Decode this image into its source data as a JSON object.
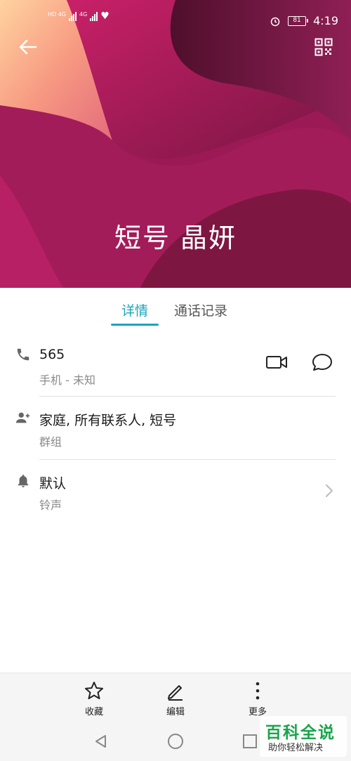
{
  "status_bar": {
    "signal_1": "HD 4G",
    "signal_2": "4G",
    "battery": "81",
    "time": "4:19",
    "alarm_icon": "alarm-icon",
    "heart_icon": "heart-icon"
  },
  "header": {
    "back_icon": "back-arrow-icon",
    "qr_icon": "qr-code-icon",
    "contact_name": "短号 晶妍"
  },
  "tabs": [
    {
      "label": "详情",
      "active": true
    },
    {
      "label": "通话记录",
      "active": false
    }
  ],
  "details": {
    "phone": {
      "number": "565",
      "type": "手机 - 未知",
      "icon": "phone-icon",
      "video_icon": "video-call-icon",
      "message_icon": "message-icon"
    },
    "groups": {
      "value": "家庭, 所有联系人, 短号",
      "label": "群组",
      "icon": "group-icon"
    },
    "ringtone": {
      "value": "默认",
      "label": "铃声",
      "icon": "bell-icon",
      "chevron_icon": "chevron-right-icon"
    }
  },
  "toolbar": {
    "favorite_label": "收藏",
    "edit_label": "编辑",
    "more_label": "更多"
  },
  "watermark": {
    "title": "百科全说",
    "subtitle": "助你轻松解决"
  },
  "colors": {
    "accent": "#1aa5b8",
    "header_primary": "#b8185e",
    "header_dark": "#5a1230"
  }
}
